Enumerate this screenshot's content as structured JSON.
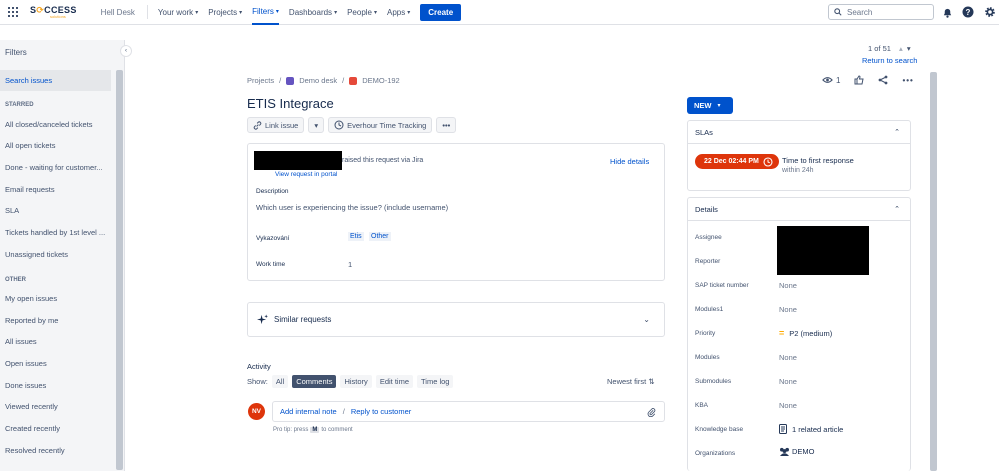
{
  "nav": {
    "logo_main_a": "S",
    "logo_main_b": "CCESS",
    "logo_sub": "solutions",
    "site_name": "Hell Desk",
    "items": [
      {
        "label": "Your work"
      },
      {
        "label": "Projects"
      },
      {
        "label": "Filters"
      },
      {
        "label": "Dashboards"
      },
      {
        "label": "People"
      },
      {
        "label": "Apps"
      }
    ],
    "create_label": "Create",
    "search_placeholder": "Search"
  },
  "sidebar": {
    "title": "Filters",
    "search_issues": "Search issues",
    "starred_heading": "STARRED",
    "starred": [
      "All closed/canceled tickets",
      "All open tickets",
      "Done - waiting for customer...",
      "Email requests",
      "SLA",
      "Tickets handled by 1st level ...",
      "Unassigned tickets"
    ],
    "other_heading": "OTHER",
    "other": [
      "My open issues",
      "Reported by me",
      "All issues",
      "Open issues",
      "Done issues",
      "Viewed recently",
      "Created recently",
      "Resolved recently"
    ]
  },
  "pager": {
    "text": "1 of 51",
    "return": "Return to search"
  },
  "breadcrumb": {
    "projects": "Projects",
    "project": "Demo desk",
    "issue_key": "DEMO-192"
  },
  "issue": {
    "title": "ETIS Integrace",
    "link_issue": "Link issue",
    "everhour": "Everhour Time Tracking",
    "watchers": "1"
  },
  "request": {
    "raised_text": "raised this request via Jira",
    "view_portal": "View request in portal",
    "hide_details": "Hide details",
    "description_label": "Description",
    "description_value": "Which user is experiencing the issue? (include username)",
    "vykazovani_label": "Vykazování",
    "tags": [
      "Etis",
      "Other"
    ],
    "worktime_label": "Work time",
    "worktime_value": "1"
  },
  "similar": {
    "label": "Similar requests"
  },
  "activity": {
    "title": "Activity",
    "show_label": "Show:",
    "filters": [
      "All",
      "Comments",
      "History",
      "Edit time",
      "Time log"
    ],
    "sort": "Newest first",
    "avatar_initials": "NV",
    "add_note": "Add internal note",
    "reply": "Reply to customer",
    "protip_a": "Pro tip: press",
    "protip_key": "M",
    "protip_b": "to comment"
  },
  "status": {
    "label": "NEW"
  },
  "sla": {
    "title": "SLAs",
    "time": "22 Dec 02:44 PM",
    "name": "Time to first response",
    "sub": "within 24h"
  },
  "details": {
    "title": "Details",
    "rows": [
      {
        "label": "Assignee",
        "value": ""
      },
      {
        "label": "Reporter",
        "value": ""
      },
      {
        "label": "SAP ticket number",
        "value": "None"
      },
      {
        "label": "Modules1",
        "value": "None"
      },
      {
        "label": "Priority",
        "value": "P2 (medium)"
      },
      {
        "label": "Modules",
        "value": "None"
      },
      {
        "label": "Submodules",
        "value": "None"
      },
      {
        "label": "KBA",
        "value": "None"
      },
      {
        "label": "Knowledge base",
        "value": "1 related article"
      },
      {
        "label": "Organizations",
        "value": "DEMO"
      }
    ]
  },
  "colors": {
    "brand": "#0052cc",
    "sla_breach": "#de350b",
    "priority": "#ffab00"
  }
}
